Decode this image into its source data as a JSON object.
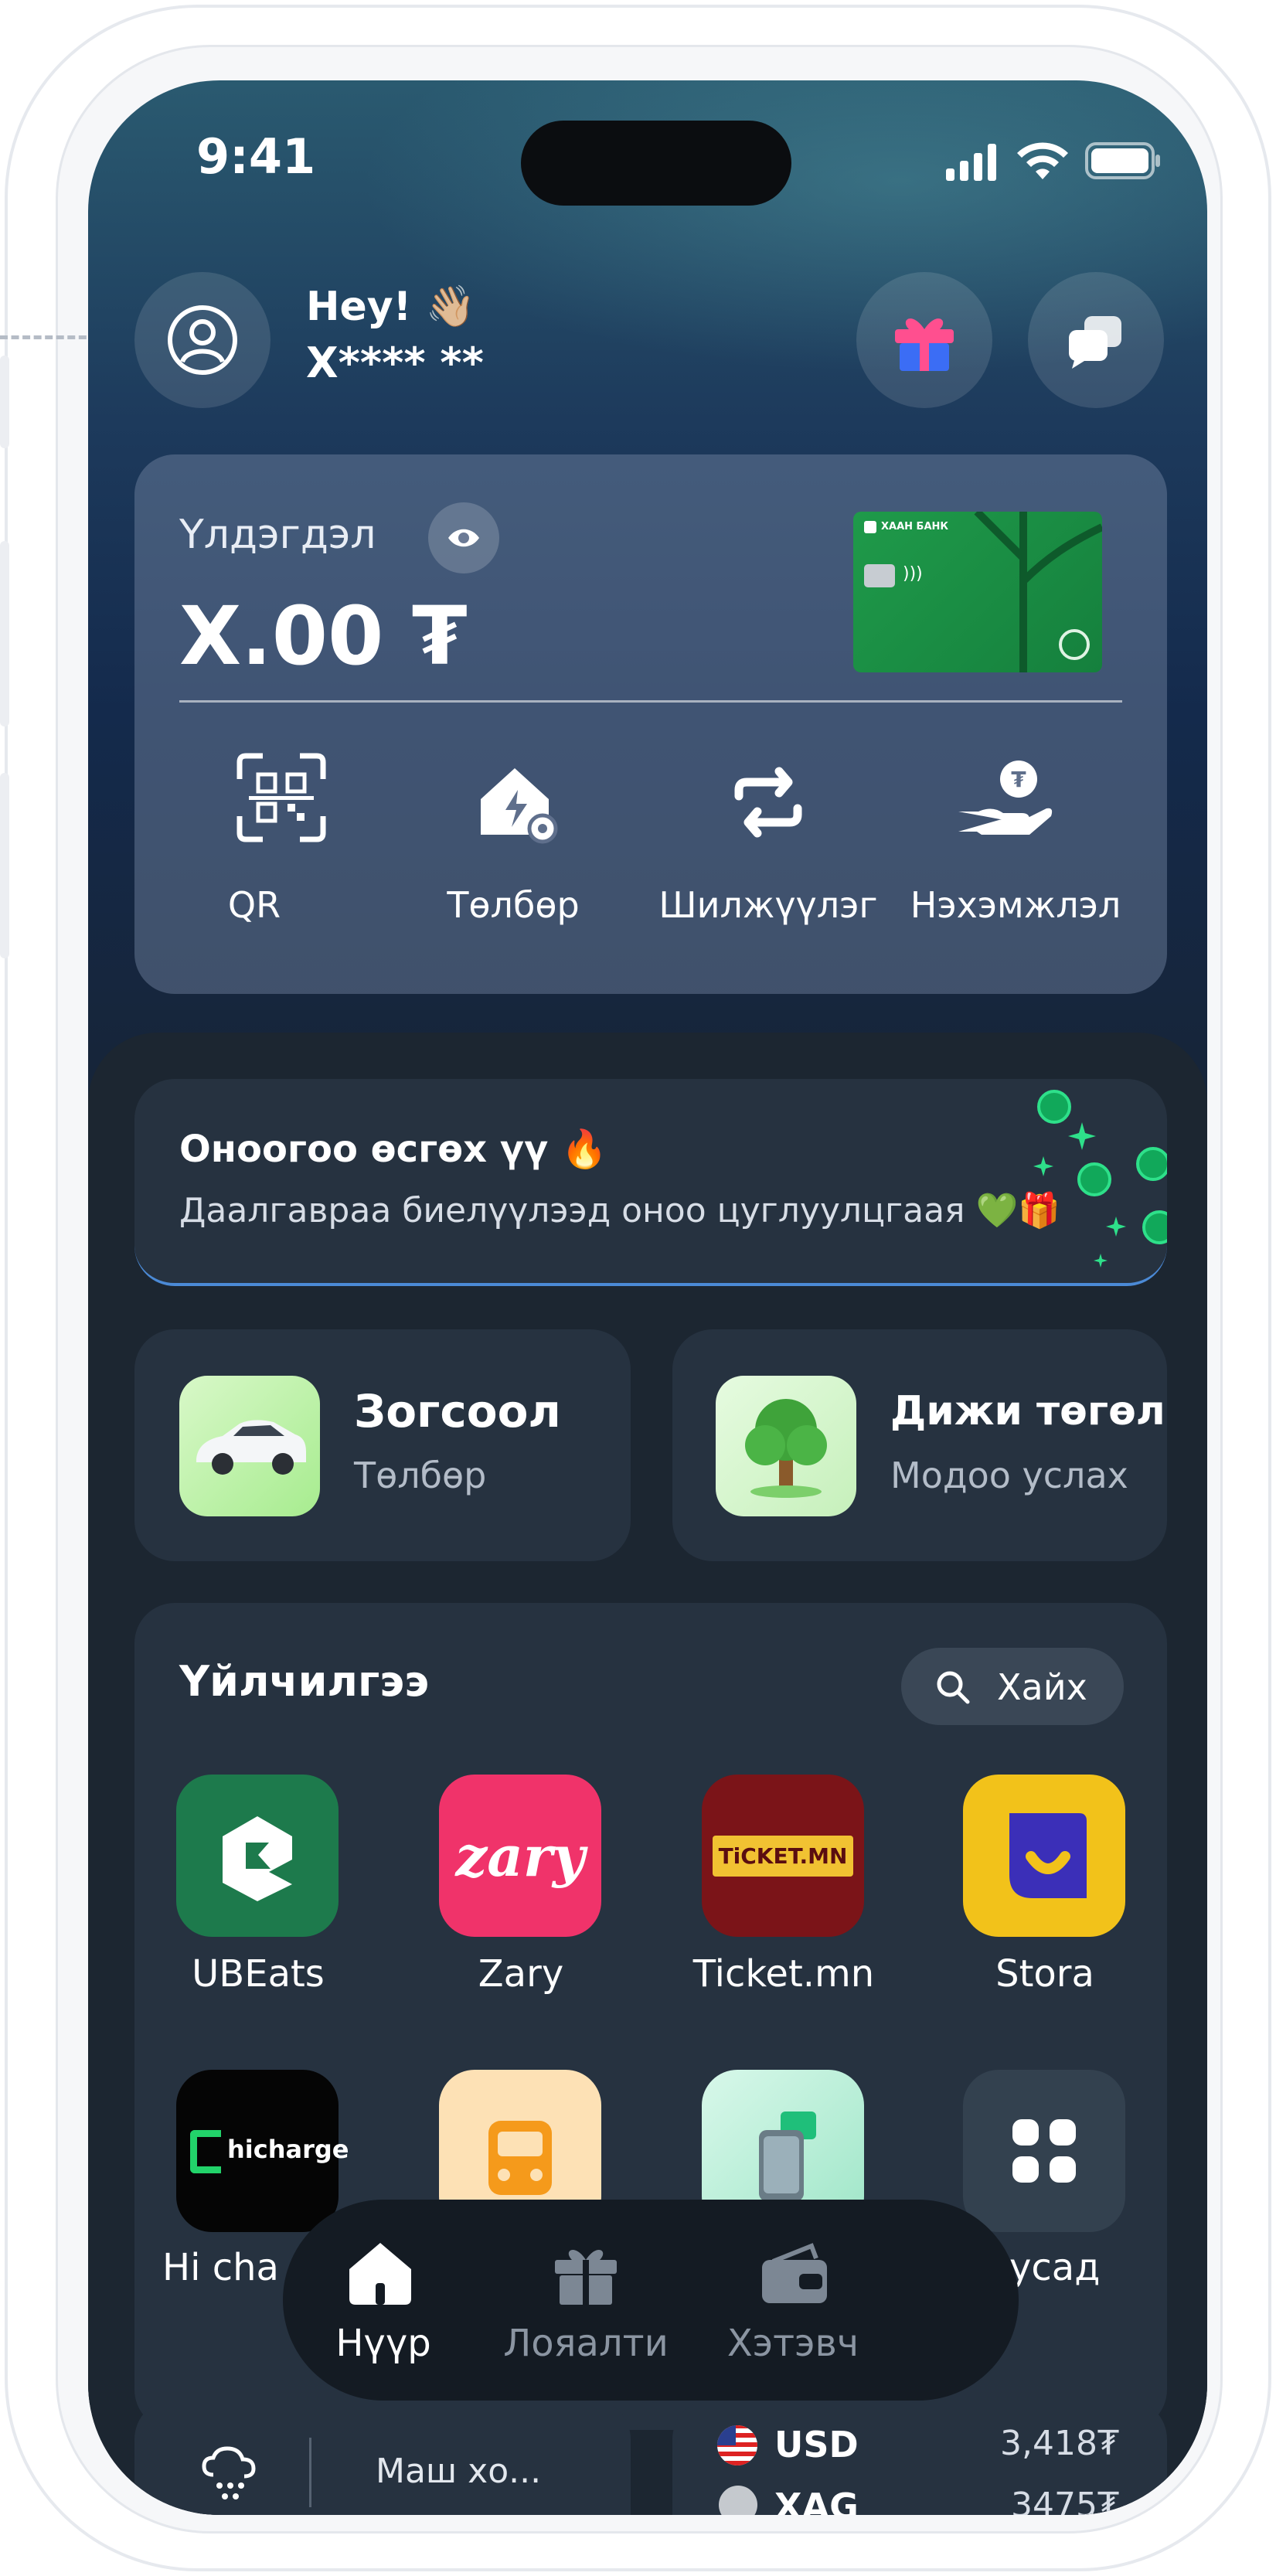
{
  "status_bar": {
    "time": "9:41"
  },
  "greeting": {
    "hello": "Hey! 👋🏼",
    "name": "Х**** **"
  },
  "balance": {
    "label": "Үлдэгдэл",
    "amount": "X.00 ₮",
    "card_brand": "ХААН БАНК"
  },
  "quick_actions": [
    {
      "label": "QR",
      "icon": "qr-scan-icon"
    },
    {
      "label": "Төлбөр",
      "icon": "house-bill-icon"
    },
    {
      "label": "Шилжүүлэг",
      "icon": "transfer-arrows-icon"
    },
    {
      "label": "Нэхэмжлэл",
      "icon": "hand-coin-icon"
    }
  ],
  "promo": {
    "title": "Оноогоо өсгөх үү 🔥",
    "subtitle": "Даалгавраа биелүүлээд оноо цуглуулцгаая 💚🎁"
  },
  "feature_tiles": [
    {
      "title": "Зогсоол",
      "subtitle": "Төлбөр",
      "icon": "car-icon"
    },
    {
      "title": "Дижи төгөл",
      "subtitle": "Модоо услах",
      "icon": "tree-icon"
    }
  ],
  "services": {
    "title": "Үйлчилгээ",
    "search_label": "Хайх",
    "items": [
      {
        "label": "UBEats",
        "icon": "ubeats-icon",
        "color": "#1d7a4c"
      },
      {
        "label": "Zary",
        "icon": "zary-icon",
        "color": "#f0336a",
        "logo_text": "zary"
      },
      {
        "label": "Ticket.mn",
        "icon": "ticket-icon",
        "color": "#7b1418",
        "logo_text": "TiCKET.MN"
      },
      {
        "label": "Stora",
        "icon": "stora-icon",
        "color": "#f2c21a"
      },
      {
        "label": "Hi cha",
        "icon": "hicharge-icon",
        "color": "#050505",
        "logo_text": "hicharge"
      },
      {
        "label": "",
        "icon": "bus-icon",
        "color": "#fde1b5"
      },
      {
        "label": "",
        "icon": "phone-icon",
        "color": "#c9f1e1"
      },
      {
        "label": "усад",
        "icon": "grid-icon",
        "color": "#33414f"
      }
    ]
  },
  "bottom_nav": [
    {
      "label": "Нүүр",
      "icon": "home-icon",
      "active": true
    },
    {
      "label": "Лояалти",
      "icon": "gift-icon",
      "active": false
    },
    {
      "label": "Хэтэвч",
      "icon": "wallet-icon",
      "active": false
    }
  ],
  "weather": {
    "text": "Маш хо..."
  },
  "rates": [
    {
      "code": "USD",
      "value": "3,418₮"
    },
    {
      "code": "XAG",
      "value": "3475₮"
    }
  ]
}
